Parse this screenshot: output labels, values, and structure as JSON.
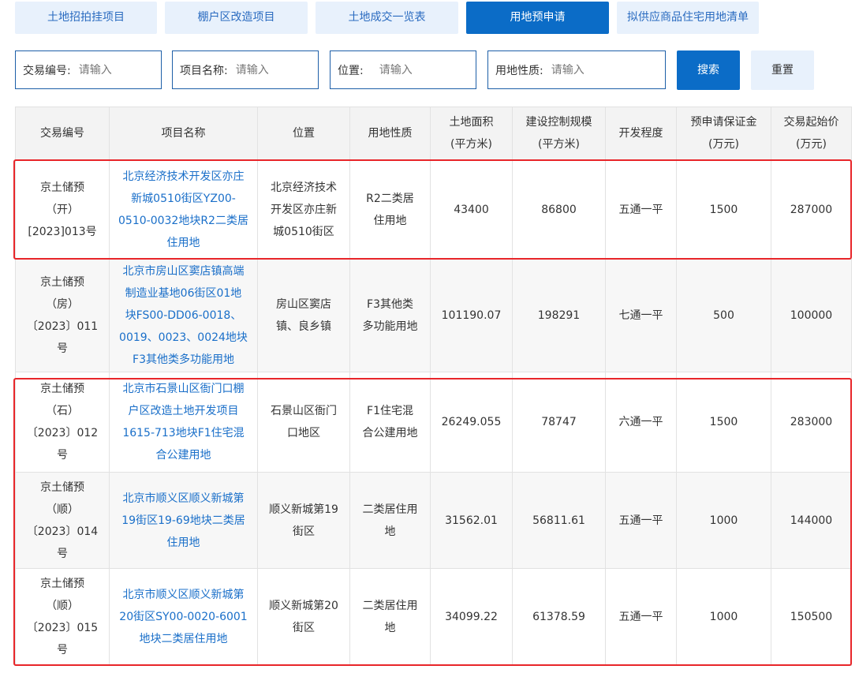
{
  "tabs": [
    {
      "label": "土地招拍挂项目",
      "active": false
    },
    {
      "label": "棚户区改造项目",
      "active": false
    },
    {
      "label": "土地成交一览表",
      "active": false
    },
    {
      "label": "用地预申请",
      "active": true
    },
    {
      "label": "拟供应商品住宅用地清单",
      "active": false
    }
  ],
  "search": {
    "fields": [
      {
        "label": "交易编号:",
        "placeholder": "请输入",
        "value": ""
      },
      {
        "label": "项目名称:",
        "placeholder": "请输入",
        "value": ""
      },
      {
        "label": "位置:",
        "placeholder": "请输入",
        "value": ""
      },
      {
        "label": "用地性质:",
        "placeholder": "请输入",
        "value": ""
      }
    ],
    "search_label": "搜索",
    "reset_label": "重置"
  },
  "table": {
    "headers": [
      [
        "交易编号"
      ],
      [
        "项目名称"
      ],
      [
        "位置"
      ],
      [
        "用地性质"
      ],
      [
        "土地面积",
        "(平方米)"
      ],
      [
        "建设控制规模",
        "(平方米)"
      ],
      [
        "开发程度"
      ],
      [
        "预申请保证金",
        "(万元)"
      ],
      [
        "交易起始价",
        "(万元)"
      ]
    ],
    "rows": [
      {
        "id": [
          "京土储预",
          "（开）",
          "[2023]013号"
        ],
        "name": [
          "北京经济技术开发区亦庄",
          "新城0510街区YZ00-",
          "0510-0032地块R2二类居",
          "住用地"
        ],
        "location": [
          "北京经济技术",
          "开发区亦庄新",
          "城0510街区"
        ],
        "use": [
          "R2二类居",
          "住用地"
        ],
        "area": "43400",
        "scale": "86800",
        "dev": "五通一平",
        "deposit": "1500",
        "price": "287000"
      },
      {
        "id": [
          "京土储预",
          "（房）",
          "〔2023〕011",
          "号"
        ],
        "name": [
          "北京市房山区窦店镇高端",
          "制造业基地06街区01地",
          "块FS00-DD06-0018、",
          "0019、0023、0024地块",
          "F3其他类多功能用地"
        ],
        "location": [
          "房山区窦店",
          "镇、良乡镇"
        ],
        "use": [
          "F3其他类",
          "多功能用地"
        ],
        "area": "101190.07",
        "scale": "198291",
        "dev": "七通一平",
        "deposit": "500",
        "price": "100000"
      },
      {
        "id": [
          "京土储预",
          "（石）",
          "〔2023〕012",
          "号"
        ],
        "name": [
          "北京市石景山区衙门口棚",
          "户区改造土地开发项目",
          "1615-713地块F1住宅混",
          "合公建用地"
        ],
        "location": [
          "石景山区衙门",
          "口地区"
        ],
        "use": [
          "F1住宅混",
          "合公建用地"
        ],
        "area": "26249.055",
        "scale": "78747",
        "dev": "六通一平",
        "deposit": "1500",
        "price": "283000"
      },
      {
        "id": [
          "京土储预",
          "（顺）",
          "〔2023〕014",
          "号"
        ],
        "name": [
          "北京市顺义区顺义新城第",
          "19街区19-69地块二类居",
          "住用地"
        ],
        "location": [
          "顺义新城第19",
          "街区"
        ],
        "use": [
          "二类居住用",
          "地"
        ],
        "area": "31562.01",
        "scale": "56811.61",
        "dev": "五通一平",
        "deposit": "1000",
        "price": "144000"
      },
      {
        "id": [
          "京土储预",
          "（顺）",
          "〔2023〕015",
          "号"
        ],
        "name": [
          "北京市顺义区顺义新城第",
          "20街区SY00-0020-6001",
          "地块二类居住用地"
        ],
        "location": [
          "顺义新城第20",
          "街区"
        ],
        "use": [
          "二类居住用",
          "地"
        ],
        "area": "34099.22",
        "scale": "61378.59",
        "dev": "五通一平",
        "deposit": "1000",
        "price": "150500"
      }
    ]
  },
  "colors": {
    "accent": "#0b6cc7",
    "tab_bg": "#e8f1fc",
    "link": "#1a6fc9",
    "highlight": "#e8262a"
  }
}
